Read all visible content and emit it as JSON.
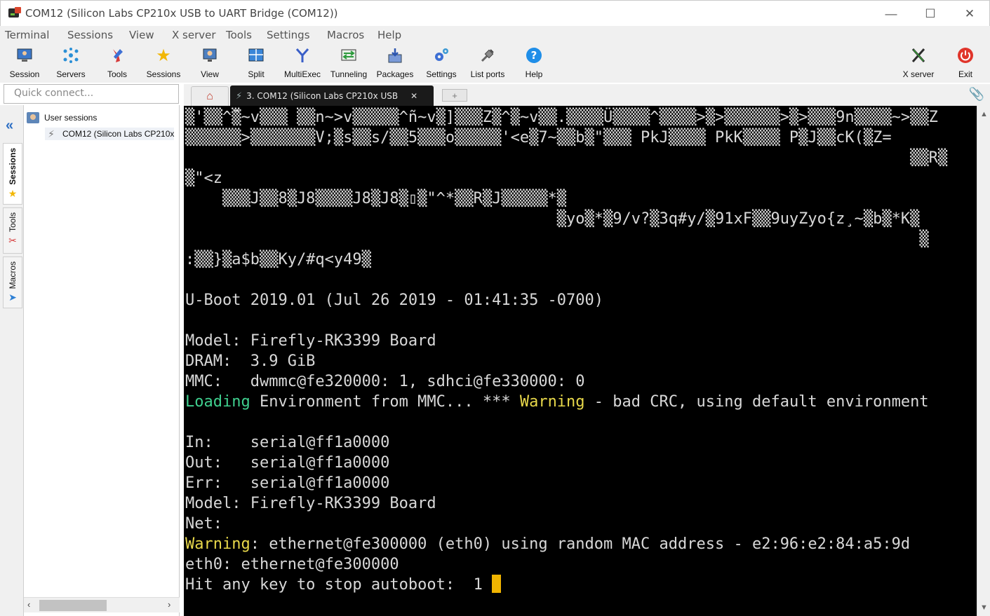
{
  "window": {
    "title": "COM12  (Silicon Labs CP210x USB to UART Bridge (COM12))",
    "controls": {
      "minimize": "—",
      "maximize": "☐",
      "close": "✕"
    }
  },
  "menu": [
    "Terminal",
    "Sessions",
    "View",
    "X server",
    "Tools",
    "Settings",
    "Macros",
    "Help"
  ],
  "toolbar": {
    "items": [
      {
        "label": "Session",
        "icon": "session-icon"
      },
      {
        "label": "Servers",
        "icon": "servers-icon"
      },
      {
        "label": "Tools",
        "icon": "tools-icon"
      },
      {
        "label": "Sessions",
        "icon": "star-icon"
      },
      {
        "label": "View",
        "icon": "view-icon"
      },
      {
        "label": "Split",
        "icon": "split-icon"
      },
      {
        "label": "MultiExec",
        "icon": "multiexec-icon"
      },
      {
        "label": "Tunneling",
        "icon": "tunneling-icon"
      },
      {
        "label": "Packages",
        "icon": "packages-icon"
      },
      {
        "label": "Settings",
        "icon": "settings-icon"
      },
      {
        "label": "List ports",
        "icon": "list-ports-icon"
      },
      {
        "label": "Help",
        "icon": "help-icon"
      }
    ],
    "right_items": [
      {
        "label": "X server",
        "icon": "x-server-icon"
      },
      {
        "label": "Exit",
        "icon": "exit-icon"
      }
    ]
  },
  "quick_connect": {
    "placeholder": "Quick connect..."
  },
  "tabs": {
    "active_label": "3. COM12  (Silicon Labs CP210x USB",
    "close": "✕",
    "new_tab": "+"
  },
  "side_tabs": [
    "Sessions",
    "Tools",
    "Macros"
  ],
  "sessions_tree": {
    "root": "User sessions",
    "items": [
      "COM12  (Silicon Labs CP210x"
    ]
  },
  "terminal": {
    "lines": [
      {
        "segments": [
          {
            "text": "▒'▒▒^̃▒~v▒▒▒ ▒▒n~>v▒▒▒▒▒^ñ~v▒]▒▒▒Z▒^▒~v▒▒.▒▒▒▒Ü▒▒▒▒^▒▒▒▒>▒>▒▒▒▒▒▒>▒>▒▒▒9n▒▒▒▒~>▒▒Z",
            "color": ""
          }
        ]
      },
      {
        "segments": [
          {
            "text": "▒▒▒▒▒▒>▒▒▒▒▒▒▒V;▒s▒▒s/▒▒5▒▒▒o▒▒▒▒▒'<e▒7~▒▒b▒\"▒▒▒ PkJ▒▒▒▒ PkK▒▒▒▒ P▒J▒▒cK(▒Z=",
            "color": ""
          }
        ]
      },
      {
        "segments": [
          {
            "text": "                                                                              ▒▒R▒",
            "color": ""
          }
        ]
      },
      {
        "segments": [
          {
            "text": "▒\"<z",
            "color": ""
          }
        ]
      },
      {
        "segments": [
          {
            "text": "    ▒▒▒J▒▒8▒J8▒▒▒▒J8▒J8▒▯▒\"^*▒▒R▒J▒▒▒▒▒*▒",
            "color": ""
          }
        ]
      },
      {
        "segments": [
          {
            "text": "                                        ▒yo▒*▒9/v?▒3q#y/▒91xF▒▒9uyZyo{z¸~▒b▒*K▒",
            "color": ""
          }
        ]
      },
      {
        "segments": [
          {
            "text": "                                                                               ▒",
            "color": ""
          }
        ]
      },
      {
        "segments": [
          {
            "text": ":▒▒}▒a$b▒▒Ky/#q<y49▒",
            "color": ""
          }
        ]
      },
      {
        "segments": [
          {
            "text": "",
            "color": ""
          }
        ]
      },
      {
        "segments": [
          {
            "text": "U-Boot 2019.01 (Jul 26 2019 - 01:41:35 -0700)",
            "color": ""
          }
        ]
      },
      {
        "segments": [
          {
            "text": "",
            "color": ""
          }
        ]
      },
      {
        "segments": [
          {
            "text": "Model: Firefly-RK3399 Board",
            "color": ""
          }
        ]
      },
      {
        "segments": [
          {
            "text": "DRAM:  3.9 GiB",
            "color": ""
          }
        ]
      },
      {
        "segments": [
          {
            "text": "MMC:   dwmmc@fe320000: 1, sdhci@fe330000: 0",
            "color": ""
          }
        ]
      },
      {
        "segments": [
          {
            "text": "Loading",
            "color": "green"
          },
          {
            "text": " Environment from MMC... *** ",
            "color": ""
          },
          {
            "text": "Warning",
            "color": "yellow"
          },
          {
            "text": " - bad CRC, using default environment",
            "color": ""
          }
        ]
      },
      {
        "segments": [
          {
            "text": "",
            "color": ""
          }
        ]
      },
      {
        "segments": [
          {
            "text": "In:    serial@ff1a0000",
            "color": ""
          }
        ]
      },
      {
        "segments": [
          {
            "text": "Out:   serial@ff1a0000",
            "color": ""
          }
        ]
      },
      {
        "segments": [
          {
            "text": "Err:   serial@ff1a0000",
            "color": ""
          }
        ]
      },
      {
        "segments": [
          {
            "text": "Model: Firefly-RK3399 Board",
            "color": ""
          }
        ]
      },
      {
        "segments": [
          {
            "text": "Net:",
            "color": ""
          }
        ]
      },
      {
        "segments": [
          {
            "text": "Warning",
            "color": "yellow"
          },
          {
            "text": ": ethernet@fe300000 (eth0) using random MAC address - e2:96:e2:84:a5:9d",
            "color": ""
          }
        ]
      },
      {
        "segments": [
          {
            "text": "eth0: ethernet@fe300000",
            "color": ""
          }
        ]
      },
      {
        "segments": [
          {
            "text": "Hit any key to stop autoboot:  1 ",
            "color": ""
          }
        ],
        "cursor": true
      }
    ]
  },
  "colors": {
    "terminal_bg": "#000000",
    "terminal_fg": "#d8d8d8",
    "green": "#3fcf8e",
    "yellow": "#e8d84a",
    "cursor": "#f0b400",
    "accent_blue": "#2d6fc4"
  }
}
